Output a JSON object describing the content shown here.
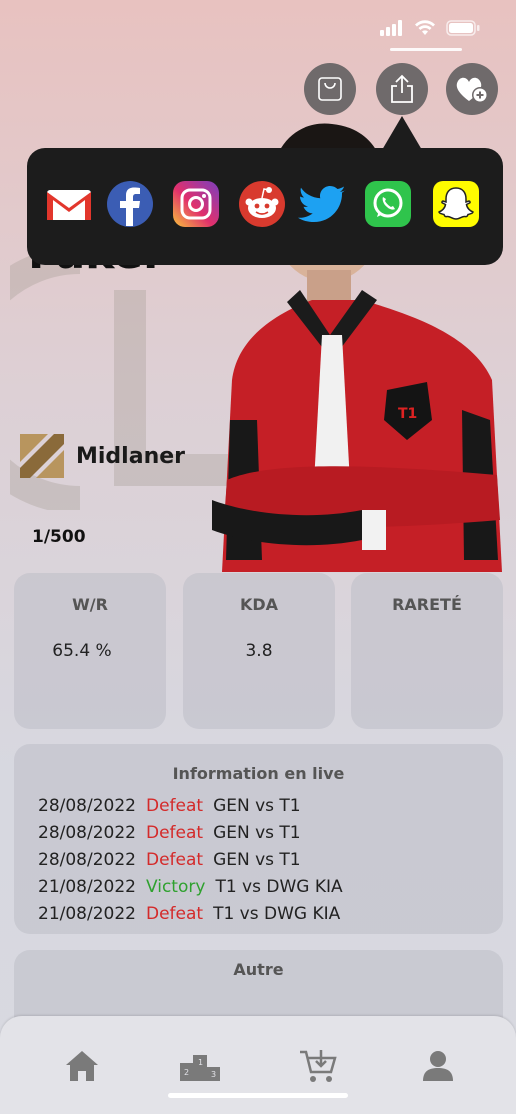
{
  "colors": {
    "accent": "#1c1c1c",
    "defeat": "#d42a2a",
    "victory": "#2fa12f"
  },
  "header": {
    "actions": [
      {
        "icon": "shopping-bag-icon"
      },
      {
        "icon": "share-icon"
      },
      {
        "icon": "favorite-add-icon"
      }
    ]
  },
  "share_menu": {
    "items": [
      {
        "icon": "gmail-icon"
      },
      {
        "icon": "facebook-icon"
      },
      {
        "icon": "instagram-icon"
      },
      {
        "icon": "reddit-icon"
      },
      {
        "icon": "twitter-icon"
      },
      {
        "icon": "whatsapp-icon"
      },
      {
        "icon": "snapchat-icon"
      }
    ]
  },
  "player": {
    "name": "Faker",
    "role": "Midlaner",
    "serial": "1/500"
  },
  "stats": [
    {
      "title": "W/R",
      "value": "65.4 %"
    },
    {
      "title": "KDA",
      "value": "3.8"
    },
    {
      "title": "RARETÉ",
      "value": ""
    }
  ],
  "live": {
    "title": "Information en live",
    "matches": [
      {
        "date": "28/08/2022",
        "result": "Defeat",
        "match": "GEN vs T1"
      },
      {
        "date": "28/08/2022",
        "result": "Defeat",
        "match": "GEN vs T1"
      },
      {
        "date": "28/08/2022",
        "result": "Defeat",
        "match": "GEN vs T1"
      },
      {
        "date": "21/08/2022",
        "result": "Victory",
        "match": "T1 vs DWG KIA"
      },
      {
        "date": "21/08/2022",
        "result": "Defeat",
        "match": "T1 vs DWG KIA"
      }
    ]
  },
  "other": {
    "title": "Autre"
  },
  "tabbar": {
    "items": [
      {
        "icon": "home-icon"
      },
      {
        "icon": "podium-icon"
      },
      {
        "icon": "cart-icon"
      },
      {
        "icon": "profile-icon"
      }
    ]
  }
}
